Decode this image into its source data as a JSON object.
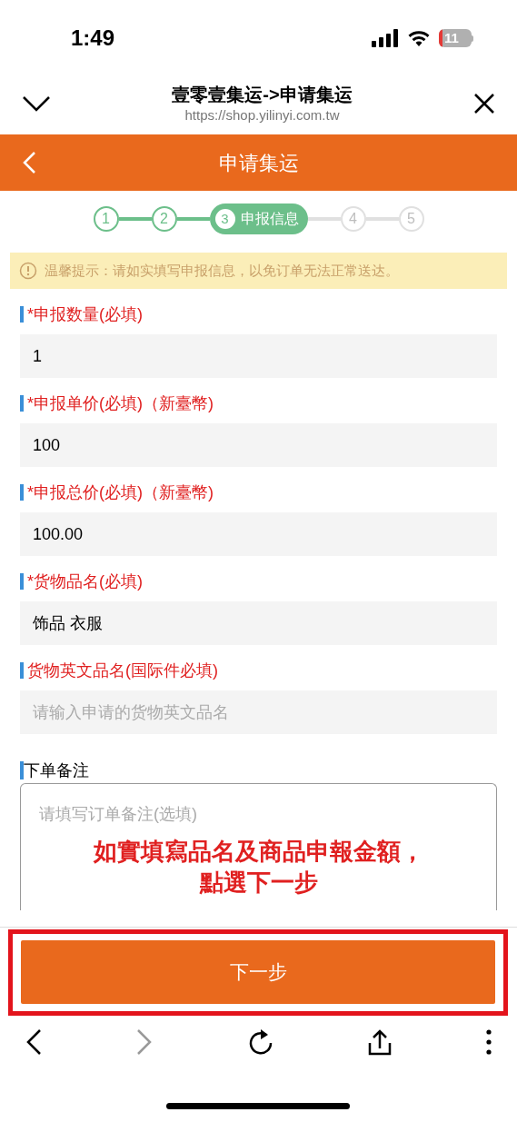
{
  "status_bar": {
    "time": "1:49",
    "battery": "11"
  },
  "browser": {
    "title": "壹零壹集运->申请集运",
    "url": "https://shop.yilinyi.com.tw"
  },
  "header": {
    "title": "申请集运"
  },
  "steps": [
    {
      "number": "1",
      "done": true,
      "selected": false
    },
    {
      "number": "2",
      "done": true,
      "selected": false
    },
    {
      "number": "3",
      "label": "申报信息",
      "done": false,
      "selected": true
    },
    {
      "number": "4",
      "done": false,
      "selected": false
    },
    {
      "number": "5",
      "done": false,
      "selected": false
    }
  ],
  "notice": "温馨提示：请如实填写申报信息，以免订单无法正常送达。",
  "fields": [
    {
      "label": "*申报数量(必填)",
      "required": true,
      "value": "1"
    },
    {
      "label": "*申报单价(必填)（新臺幣)",
      "required": true,
      "value": "100"
    },
    {
      "label": "*申报总价(必填)（新臺幣)",
      "required": true,
      "value": "100.00"
    },
    {
      "label": "*货物品名(必填)",
      "required": true,
      "value": "饰品 衣服"
    },
    {
      "label": "货物英文品名(国际件必填)",
      "required": true,
      "placeholder": "请输入申请的货物英文品名"
    }
  ],
  "notes": {
    "label": "下单备注",
    "placeholder": "请填写订单备注(选填)"
  },
  "annotation": [
    "如實填寫品名及商品申報金額，",
    "點選下一步"
  ],
  "next_button": "下一步"
}
